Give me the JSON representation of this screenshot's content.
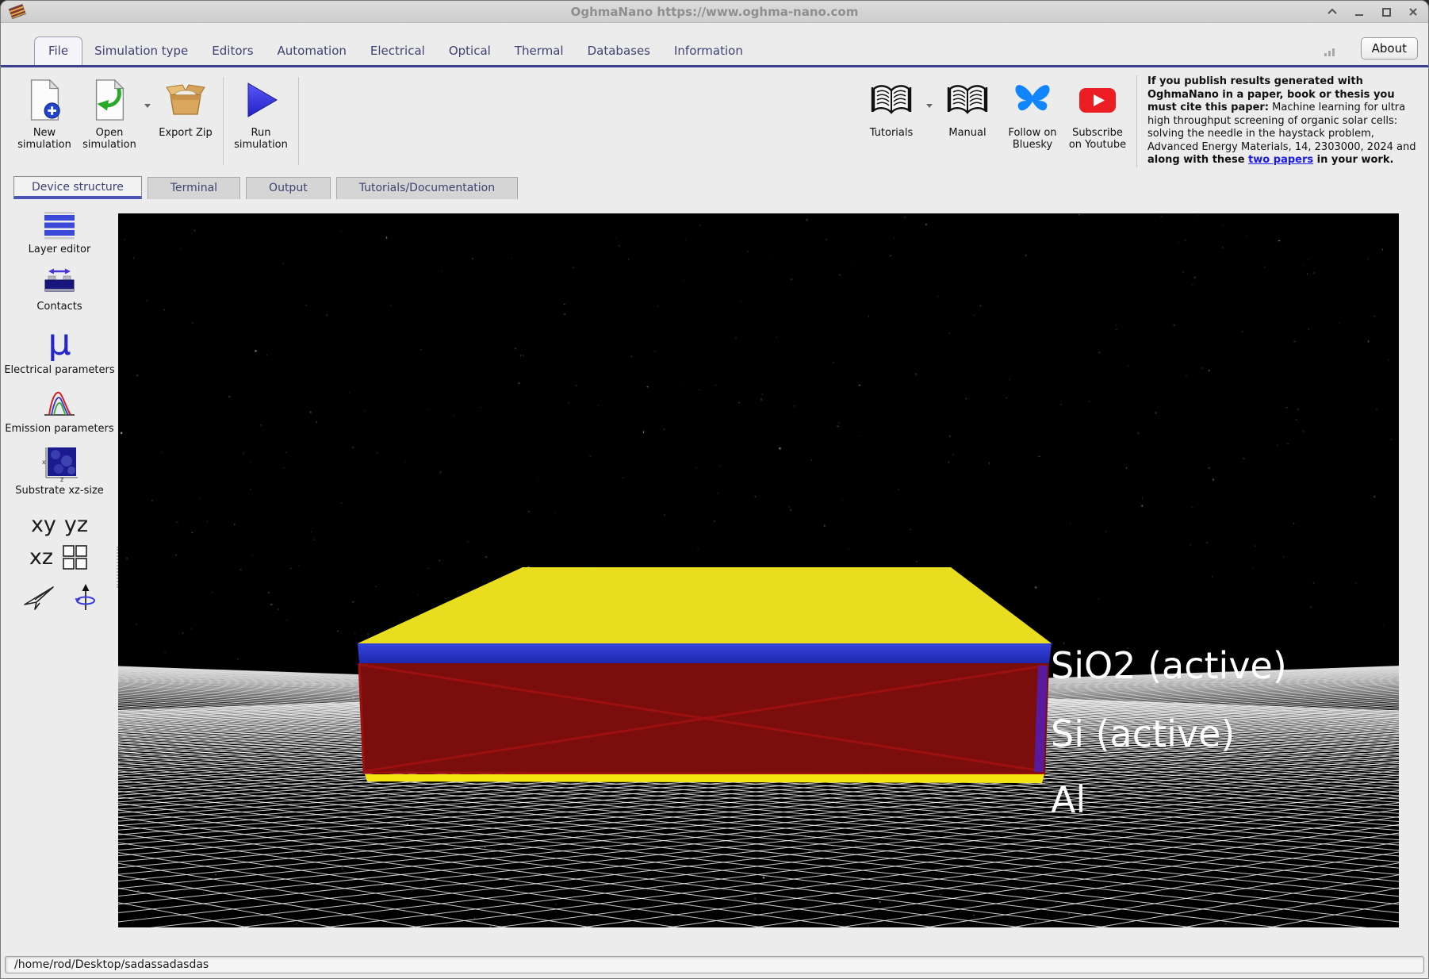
{
  "window": {
    "title": "OghmaNano https://www.oghma-nano.com"
  },
  "menu": {
    "items": [
      "File",
      "Simulation type",
      "Editors",
      "Automation",
      "Electrical",
      "Optical",
      "Thermal",
      "Databases",
      "Information"
    ],
    "active": "File",
    "about": "About"
  },
  "toolbar": {
    "new": "New simulation",
    "open": "Open simulation",
    "export": "Export Zip",
    "run": "Run simulation",
    "tutorials": "Tutorials",
    "manual": "Manual",
    "bluesky": "Follow on Bluesky",
    "youtube": "Subscribe on Youtube",
    "citation": {
      "bold_intro": "If you publish results generated with OghmaNano in a paper, book or thesis you must cite this paper:",
      "body": " Machine learning for ultra high throughput screening of organic solar cells: solving the needle in the haystack problem, Advanced Energy Materials, 14, 2303000, 2024 and ",
      "bold_mid": "along with these ",
      "link": "two papers",
      "bold_end": " in your work."
    }
  },
  "doc_tabs": {
    "items": [
      "Device structure",
      "Terminal",
      "Output",
      "Tutorials/Documentation"
    ],
    "active": "Device structure"
  },
  "sidebar": {
    "items": [
      "Layer editor",
      "Contacts",
      "Electrical parameters",
      "Emission parameters",
      "Substrate xz-size"
    ],
    "views": [
      "xy",
      "yz",
      "xz"
    ]
  },
  "scene": {
    "layers": [
      "SiO2 (active)",
      "Si (active)",
      "Al"
    ],
    "colors": {
      "background": "#000000",
      "grid_line": "#ffffff",
      "top_face": "#e9dd1f",
      "sio2_layer": "#2531c4",
      "si_layer": "#7c0d0d",
      "si_edge": "#9e1111",
      "side_strip": "#5a1a9e",
      "al_layer": "#f4e60e",
      "label_text": "#ffffff"
    }
  },
  "status": {
    "path": "/home/rod/Desktop/sadassadasdas"
  },
  "icons": {
    "mu": "μ",
    "substrate_x": "x",
    "substrate_z": "z"
  }
}
